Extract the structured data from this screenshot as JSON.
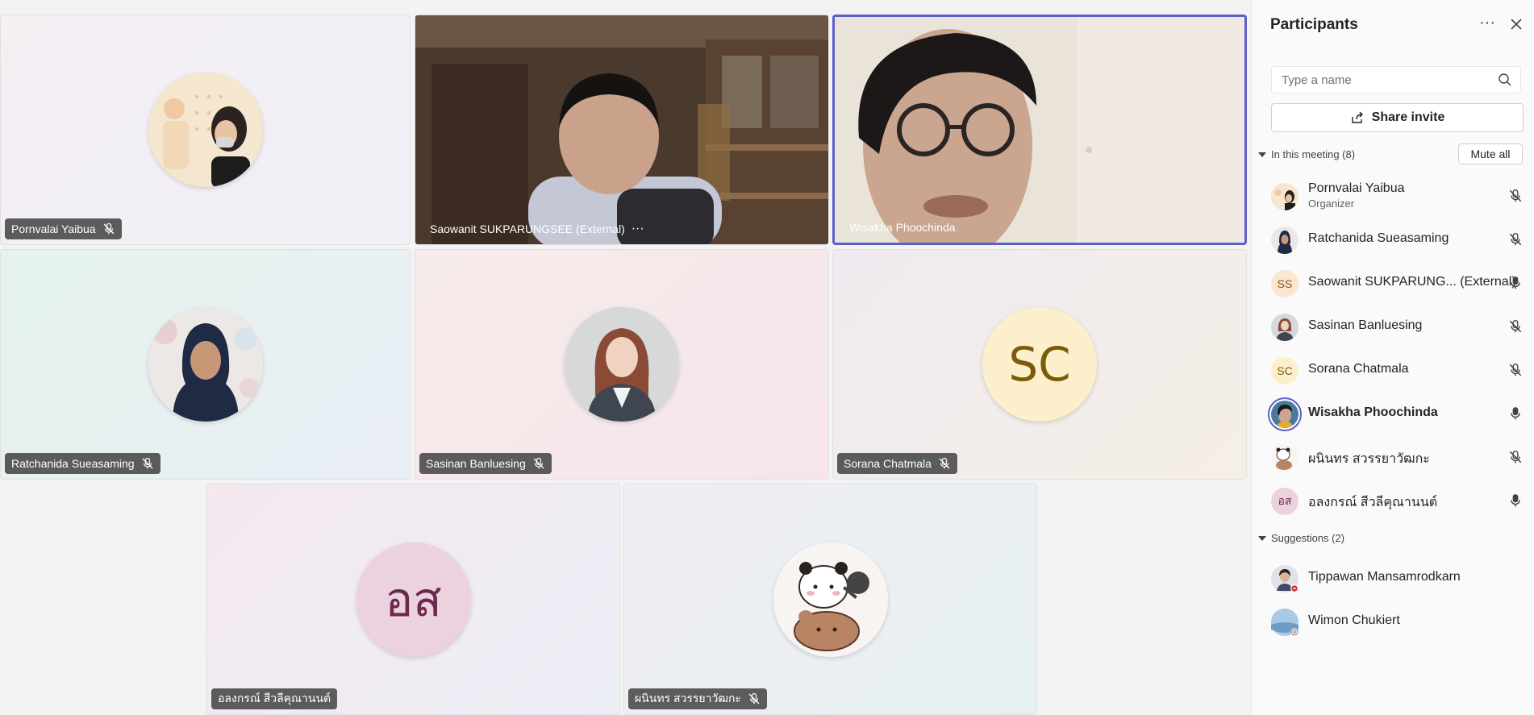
{
  "tiles": [
    {
      "name": "Pornvalai Yaibua",
      "mic": "muted"
    },
    {
      "name": "Saowanit SUKPARUNGSEE (External)",
      "more": "···"
    },
    {
      "name": "Wisakha Phoochinda"
    },
    {
      "name": "Ratchanida Sueasaming",
      "mic": "muted"
    },
    {
      "name": "Sasinan Banluesing",
      "mic": "muted"
    },
    {
      "name": "Sorana Chatmala",
      "mic": "muted",
      "initials": "SC"
    },
    {
      "name": "อลงกรณ์ สีวลีคุณานนต์",
      "initials": "อส"
    },
    {
      "name": "ผนินทร สวรรยาวัฒกะ",
      "mic": "muted"
    }
  ],
  "panel": {
    "title": "Participants",
    "more_label": "···",
    "search_placeholder": "Type a name",
    "share_label": "Share invite",
    "in_meeting_label": "In this meeting (8)",
    "mute_all_label": "Mute all",
    "participants": [
      {
        "name": "Pornvalai Yaibua",
        "role": "Organizer",
        "mic": "muted"
      },
      {
        "name": "Ratchanida Sueasaming",
        "mic": "muted"
      },
      {
        "name": "Saowanit SUKPARUNG...",
        "tag": "(External)",
        "initials": "SS",
        "mic": "on"
      },
      {
        "name": "Sasinan Banluesing",
        "mic": "muted"
      },
      {
        "name": "Sorana Chatmala",
        "initials": "SC",
        "mic": "muted"
      },
      {
        "name": "Wisakha Phoochinda",
        "mic": "on",
        "speaking": true
      },
      {
        "name": "ผนินทร สวรรยาวัฒกะ",
        "mic": "muted"
      },
      {
        "name": "อลงกรณ์ สีวลีคุณานนต์",
        "initials": "อส",
        "mic": "on"
      }
    ],
    "suggestions_label": "Suggestions (2)",
    "suggestions": [
      {
        "name": "Tippawan Mansamrodkarn",
        "status": "busy"
      },
      {
        "name": "Wimon Chukiert",
        "status": "offline"
      }
    ]
  },
  "colors": {
    "accent": "#5b5fc7",
    "sc_avatar_bg": "#fcefcc",
    "sc_avatar_text": "#7a5b0a",
    "th_avatar_bg": "#ecd1df",
    "th_avatar_text": "#6b2a4d"
  }
}
